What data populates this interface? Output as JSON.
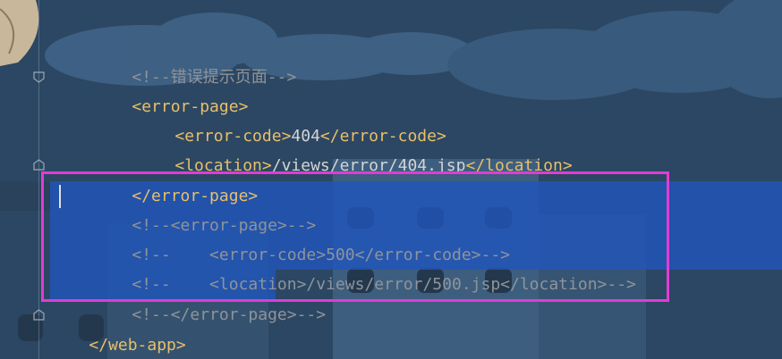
{
  "editor": {
    "lines": [
      {
        "segments": [
          {
            "kind": "cm",
            "text": "<!--错误提示页面-->"
          }
        ]
      },
      {
        "segments": [
          {
            "kind": "tag",
            "text": "<error-page>"
          }
        ]
      },
      {
        "segments": [
          {
            "kind": "tag",
            "text": "<error-code>"
          },
          {
            "kind": "txt",
            "text": "404"
          },
          {
            "kind": "tag",
            "text": "</error-code>"
          }
        ]
      },
      {
        "segments": [
          {
            "kind": "tag",
            "text": "<location>"
          },
          {
            "kind": "txt",
            "text": "/views/error/404.jsp"
          },
          {
            "kind": "tag",
            "text": "</location>"
          }
        ]
      },
      {
        "segments": [
          {
            "kind": "tag",
            "text": "</error-page>"
          }
        ]
      },
      {
        "segments": [
          {
            "kind": "cm",
            "text": "<!--<error-page>-->"
          }
        ]
      },
      {
        "segments": [
          {
            "kind": "cm",
            "text": "<!--    <error-code>500</error-code>-->"
          }
        ]
      },
      {
        "segments": [
          {
            "kind": "cm",
            "text": "<!--    <location>/views/error/500.jsp</location>-->"
          }
        ]
      },
      {
        "segments": [
          {
            "kind": "cm",
            "text": "<!--</error-page>-->"
          }
        ]
      },
      {
        "segments": [
          {
            "kind": "tag",
            "text": "</web-app>"
          }
        ]
      }
    ]
  },
  "colors": {
    "background": "#2c4763",
    "selection": "#2056be",
    "tag": "#e8bf6a",
    "comment": "#8f9499",
    "highlight_box": "#e23bd6"
  }
}
